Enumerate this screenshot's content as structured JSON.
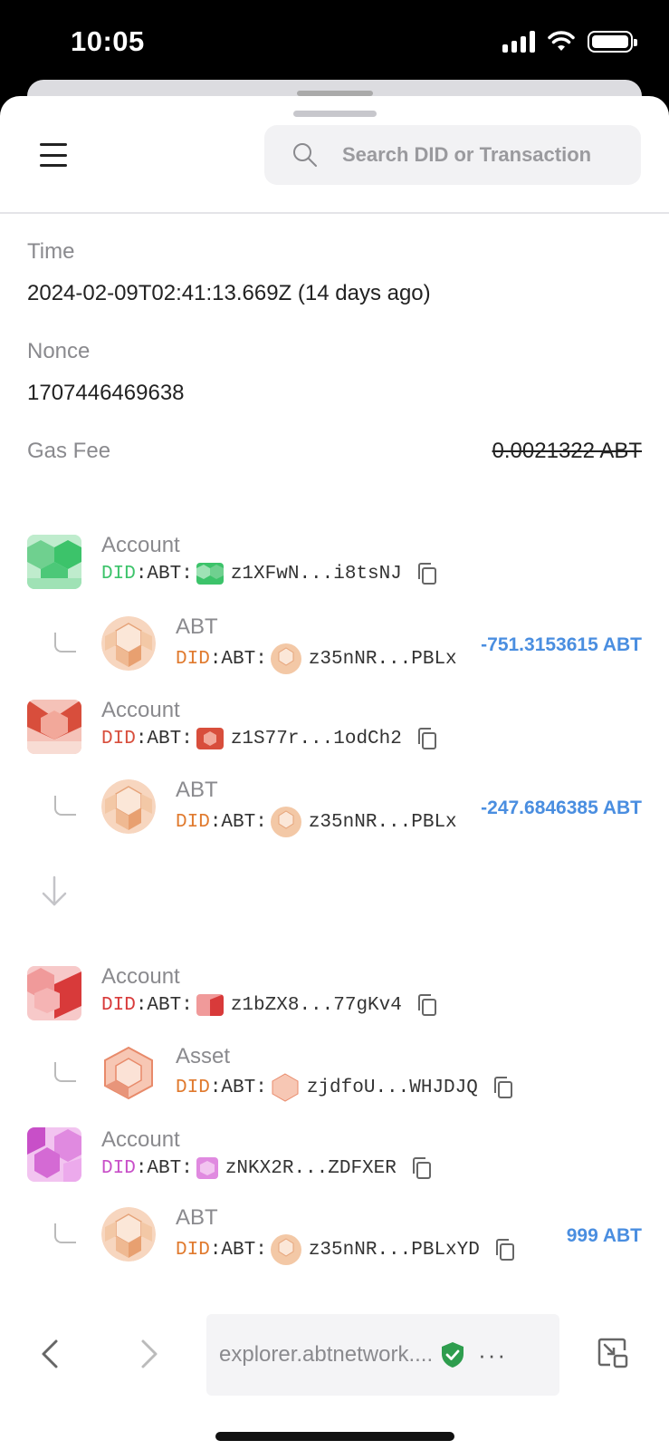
{
  "status_bar": {
    "time": "10:05"
  },
  "search": {
    "placeholder": "Search DID or Transaction"
  },
  "fields": {
    "time_label": "Time",
    "time_value": "2024-02-09T02:41:13.669Z (14 days ago)",
    "nonce_label": "Nonce",
    "nonce_value": "1707446469638",
    "gas_label": "Gas Fee",
    "gas_value": "0.0021322 ABT"
  },
  "rows": [
    {
      "title": "Account",
      "did_prefix_colored": "DID",
      "did_prefix_rest": ":ABT:",
      "address": "z1XFwN...i8tsNJ",
      "color": "#3cc36a"
    },
    {
      "title": "ABT",
      "did_prefix_colored": "DID",
      "did_prefix_rest": ":ABT:",
      "address": "z35nNR...PBLx",
      "amount": "-751.3153615 ABT",
      "color": "#e07a2e"
    },
    {
      "title": "Account",
      "did_prefix_colored": "DID",
      "did_prefix_rest": ":ABT:",
      "address": "z1S77r...1odCh2",
      "color": "#d84e3c"
    },
    {
      "title": "ABT",
      "did_prefix_colored": "DID",
      "did_prefix_rest": ":ABT:",
      "address": "z35nNR...PBLx",
      "amount": "-247.6846385 ABT",
      "color": "#e07a2e"
    },
    {
      "title": "Account",
      "did_prefix_colored": "DID",
      "did_prefix_rest": ":ABT:",
      "address": "z1bZX8...77gKv4",
      "color": "#d83a3a"
    },
    {
      "title": "Asset",
      "did_prefix_colored": "DID",
      "did_prefix_rest": ":ABT:",
      "address": "zjdfoU...WHJDJQ",
      "color": "#e07a2e"
    },
    {
      "title": "Account",
      "did_prefix_colored": "DID",
      "did_prefix_rest": ":ABT:",
      "address": "zNKX2R...ZDFXER",
      "color": "#c84fc8"
    },
    {
      "title": "ABT",
      "did_prefix_colored": "DID",
      "did_prefix_rest": ":ABT:",
      "address": "z35nNR...PBLxYD",
      "amount": "999 ABT",
      "color": "#e07a2e"
    }
  ],
  "browser": {
    "url": "explorer.abtnetwork...."
  },
  "colors": {
    "accent_blue": "#4a8ee0",
    "orange": "#e07a2e",
    "red": "#d84e3c",
    "green": "#3cc36a",
    "purple": "#c84fc8"
  },
  "icons": [
    "hamburger-menu-icon",
    "search-icon",
    "copy-icon",
    "down-arrow-icon",
    "back-icon",
    "forward-icon",
    "shield-check-icon",
    "more-icon",
    "pip-icon"
  ]
}
